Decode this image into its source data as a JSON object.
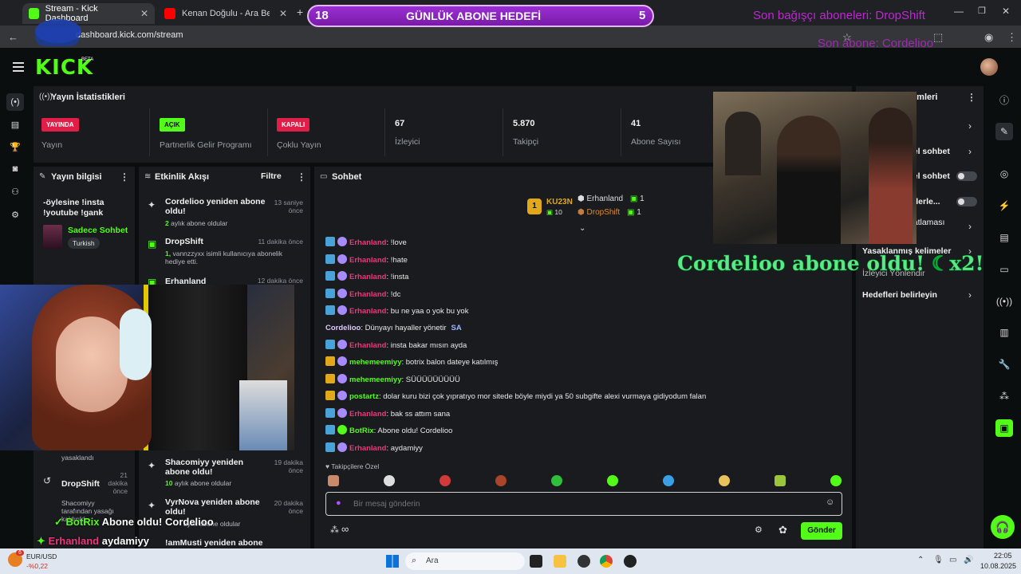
{
  "browser": {
    "tabs": [
      {
        "label": "Stream - Kick Dashboard",
        "active": true
      },
      {
        "label": "Kenan Doğulu - Ara Beni Lütfe",
        "active": false
      }
    ],
    "url": "dashboard.kick.com/stream"
  },
  "overlay": {
    "goal_left": "18",
    "goal_label": "GÜNLÜK ABONE HEDEFİ",
    "goal_right": "5",
    "last_donor": "Son bağışçı aboneleri: DropShift",
    "last_sub": "Son abone: Cordelioo",
    "sub_alert": "Cordelioo abone oldu! ☾x2!",
    "bottom_alert_user": "BotRix",
    "bottom_alert_text": "Abone oldu! Cordelioo",
    "bottom_chat_user": "Erhanland",
    "bottom_chat_text": "aydamiyy"
  },
  "header": {
    "logo": "KICK",
    "beta": "BETA"
  },
  "stats": {
    "title": "Yayın İstatistikleri",
    "cards": [
      {
        "badge": "YAYINDA",
        "label": "Yayın",
        "badge_color": "#e11d48"
      },
      {
        "badge": "AÇIK",
        "label": "Partnerlik Gelir Programı",
        "badge_color": "#53fc18"
      },
      {
        "badge": "KAPALI",
        "label": "Çoklu Yayın",
        "badge_color": "#e11d48"
      }
    ],
    "numbers": [
      {
        "value": "67",
        "label": "İzleyici"
      },
      {
        "value": "5.870",
        "label": "Takipçi"
      },
      {
        "value": "41",
        "label": "Abone Sayısı"
      }
    ]
  },
  "stream_info": {
    "title": "Yayın bilgisi",
    "stream_title": "-öylesine !insta !youtube !gank",
    "category": "Sadece Sohbet",
    "tag": "Turkish"
  },
  "activity": {
    "title": "Etkinlik Akışı",
    "filter": "Filtre",
    "items": [
      {
        "title": "Cordelioo yeniden abone oldu!",
        "time": "13 saniye önce",
        "sub_num": "2",
        "sub": "aylık abone oldular"
      },
      {
        "title": "DropShift",
        "time": "11 dakika önce",
        "sub_num": "1,",
        "sub": "vannzzyxx isimli kullanıcıya abonelik hediye etti."
      },
      {
        "title": "Erhanland",
        "time": "12 dakika önce"
      },
      {
        "title": "Shacomiyy yeniden abone oldu!",
        "time": "19 dakika önce",
        "sub_num": "10",
        "sub": "aylık abone oldular"
      },
      {
        "title": "VyrNova yeniden abone oldu!",
        "time": "20 dakika önce",
        "sub": "aylık abone oldular"
      },
      {
        "title": "!amMusti yeniden abone"
      }
    ],
    "left_items": [
      {
        "title": "DropShift",
        "time": "21 dakika önce",
        "sub": "Shacomiyy tarafından yasağı kaldırıldı"
      },
      {
        "extra": "yasaklandı"
      }
    ]
  },
  "chat": {
    "title": "Sohbet",
    "leader": {
      "name": "KU23N",
      "num": "10"
    },
    "top": [
      {
        "name": "Erhanland",
        "count": "1"
      },
      {
        "name": "DropShift",
        "count": "1"
      }
    ],
    "messages": [
      {
        "user": "Erhanland",
        "text": "!love",
        "color": "#f0367a"
      },
      {
        "user": "Erhanland",
        "text": "!hate",
        "color": "#f0367a"
      },
      {
        "user": "Erhanland",
        "text": "!insta",
        "color": "#f0367a"
      },
      {
        "user": "Erhanland",
        "text": "!dc",
        "color": "#f0367a"
      },
      {
        "user": "Erhanland",
        "text": "bu ne yaa o yok bu yok",
        "color": "#f0367a"
      },
      {
        "user": "Cordelioo",
        "text": "Dünyayı hayaller yönetir",
        "color": "#e0c6ff"
      },
      {
        "user": "Erhanland",
        "text": "insta bakar mısın ayda",
        "color": "#f0367a"
      },
      {
        "user": "mehemeemiyy",
        "text": "botrix balon dateye katılmış",
        "color": "#53fc18"
      },
      {
        "user": "mehemeemiyy",
        "text": "SÜÜÜÜÜÜÜÜÜ",
        "color": "#53fc18"
      },
      {
        "user": "postartz",
        "text": "dolar kuru bizi çok yıpratıyo mor sitede böyle miydi ya 50 subgifte alexi vurmaya gidiyodum falan",
        "color": "#53fc18"
      },
      {
        "user": "Erhanland",
        "text": "bak ss attım sana",
        "color": "#f0367a"
      },
      {
        "user": "BotRix",
        "text": "Abone oldu! Cordelioo",
        "color": "#53fc18"
      },
      {
        "user": "Erhanland",
        "text": "aydamiyy",
        "color": "#f0367a"
      }
    ],
    "sa_badge": "SA",
    "emote_label": "Takipçilere Özel",
    "placeholder": "Bir mesaj gönderin",
    "send": "Gönder",
    "infinity": "∞"
  },
  "right_panel": {
    "title": "...mleri",
    "items": [
      {
        "label": "...el sohbet",
        "type": "chevron"
      },
      {
        "label": "...el sohbet",
        "type": "toggle"
      },
      {
        "label": "...derle...",
        "type": "toggle"
      },
      {
        "label": "...atlaması",
        "type": "chevron"
      },
      {
        "label": "Yasaklanmış kelimeler",
        "type": "chevron"
      },
      {
        "label": "İzleyici Yönlendir",
        "type": "none"
      },
      {
        "label": "Hedefleri belirleyin",
        "type": "chevron"
      }
    ]
  },
  "taskbar": {
    "ticker": "EUR/USD",
    "ticker_change": "-%0,22",
    "search": "Ara",
    "time": "22:05",
    "date": "10.08.2025",
    "notif": "6"
  }
}
